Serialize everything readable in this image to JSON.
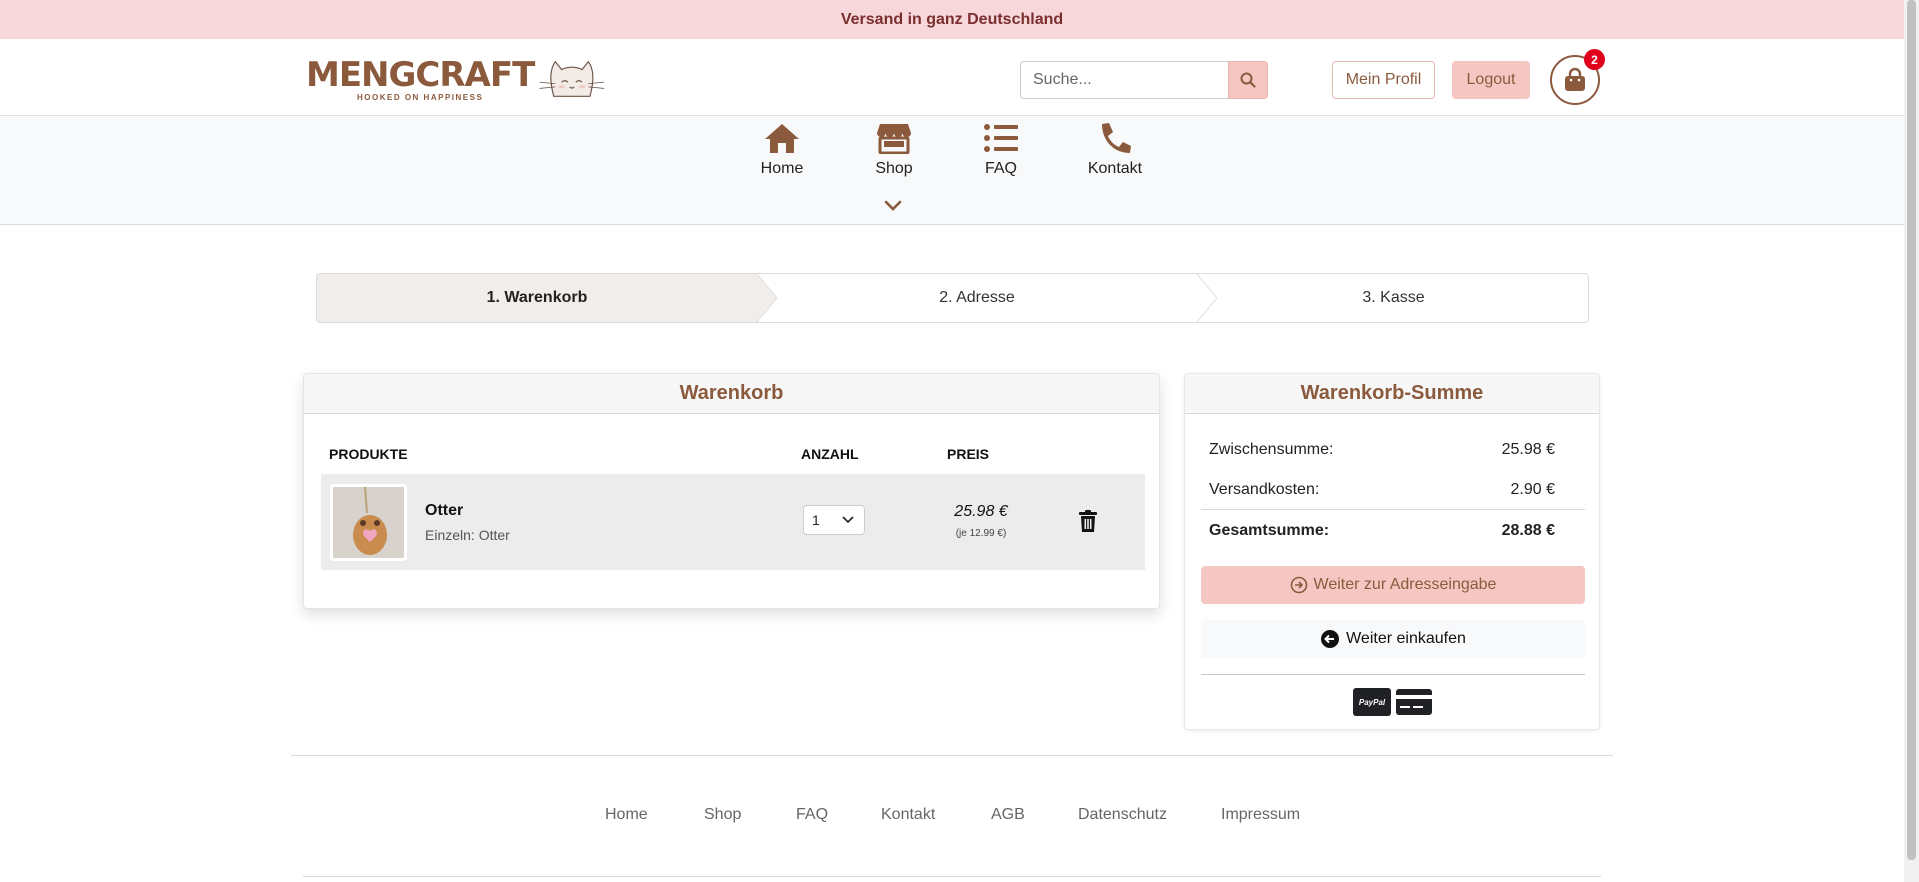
{
  "banner": {
    "text": "Versand in ganz Deutschland"
  },
  "logo": {
    "word": "MENGCRAFT",
    "tagline": "HOOKED ON HAPPINESS"
  },
  "search": {
    "placeholder": "Suche...",
    "value": ""
  },
  "header": {
    "profile_label": "Mein Profil",
    "logout_label": "Logout",
    "cart_count": "2"
  },
  "nav": {
    "items": [
      {
        "label": "Home",
        "icon": "home-icon"
      },
      {
        "label": "Shop",
        "icon": "store-icon"
      },
      {
        "label": "FAQ",
        "icon": "list-icon"
      },
      {
        "label": "Kontakt",
        "icon": "phone-icon"
      }
    ]
  },
  "steps": [
    {
      "label": "1. Warenkorb",
      "active": true
    },
    {
      "label": "2. Adresse",
      "active": false
    },
    {
      "label": "3. Kasse",
      "active": false
    }
  ],
  "cart": {
    "title": "Warenkorb",
    "columns": {
      "products": "PRODUKTE",
      "quantity": "ANZAHL",
      "price": "PREIS"
    },
    "items": [
      {
        "name": "Otter",
        "variant": "Einzeln: Otter",
        "quantity": "1",
        "price": "25.98 €",
        "unit_price": "(je 12.99 €)"
      }
    ]
  },
  "summary": {
    "title": "Warenkorb-Summe",
    "subtotal_label": "Zwischensumme:",
    "subtotal_value": "25.98 €",
    "shipping_label": "Versandkosten:",
    "shipping_value": "2.90 €",
    "total_label": "Gesamtsumme:",
    "total_value": "28.88 €",
    "next_label": "Weiter zur Adresseingabe",
    "continue_label": "Weiter einkaufen",
    "payment_paypal": "PayPal"
  },
  "footer": {
    "links": [
      "Home",
      "Shop",
      "FAQ",
      "Kontakt",
      "AGB",
      "Datenschutz",
      "Impressum"
    ]
  },
  "colors": {
    "brand": "#8b5a3c",
    "accent": "#f4c7c3",
    "banner": "#f8d7da",
    "badge": "#e0001b"
  }
}
